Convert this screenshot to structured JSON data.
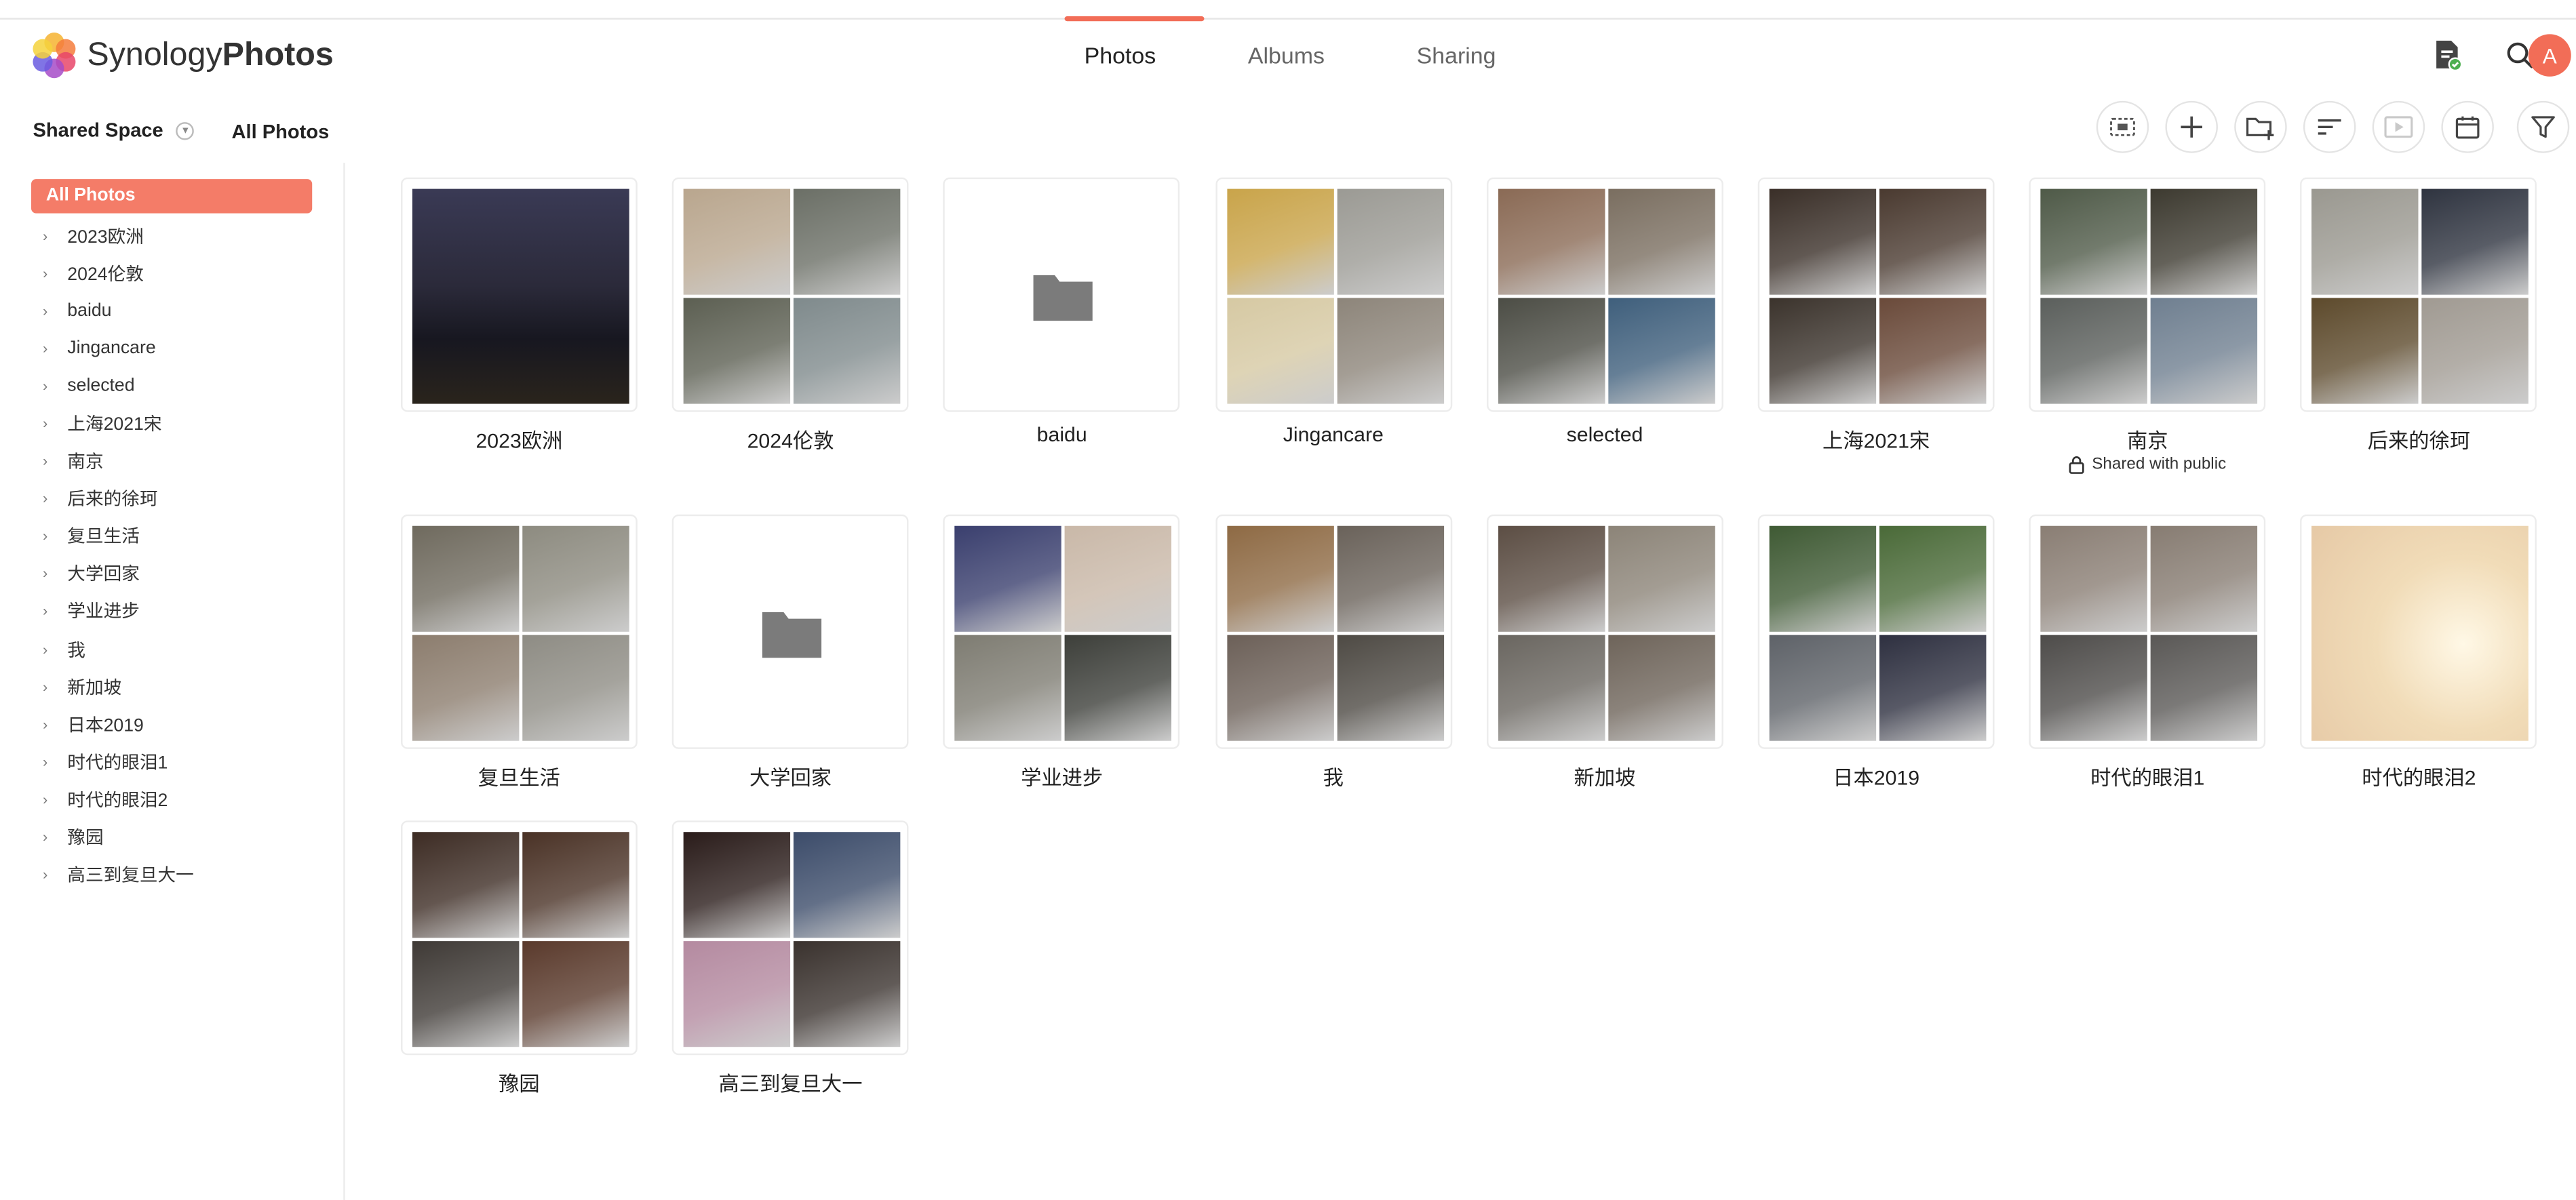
{
  "app": {
    "brand_light": "Synology",
    "brand_bold": "Photos",
    "accent_color": "#f26d57"
  },
  "header": {
    "tabs": [
      {
        "label": "Photos",
        "active": true
      },
      {
        "label": "Albums",
        "active": false
      },
      {
        "label": "Sharing",
        "active": false
      }
    ],
    "icons": [
      "task-status-icon",
      "search-icon"
    ],
    "avatar_letter": "A"
  },
  "subheader": {
    "space": "Shared Space",
    "current": "All Photos",
    "toolbar": [
      {
        "name": "select-icon",
        "disabled": false
      },
      {
        "name": "plus-icon",
        "disabled": false
      },
      {
        "name": "new-folder-icon",
        "disabled": false
      },
      {
        "name": "sort-icon",
        "disabled": false
      },
      {
        "name": "slideshow-icon",
        "disabled": true
      },
      {
        "name": "calendar-icon",
        "disabled": false
      },
      {
        "name": "filter-icon",
        "disabled": false
      }
    ]
  },
  "sidebar": {
    "active": "All Photos",
    "items": [
      "2023欧洲",
      "2024伦敦",
      "baidu",
      "Jingancare",
      "selected",
      "上海2021宋",
      "南京",
      "后来的徐珂",
      "复旦生活",
      "大学回家",
      "学业进步",
      "我",
      "新加坡",
      "日本2019",
      "时代的眼泪1",
      "时代的眼泪2",
      "豫园",
      "高三到复旦大一"
    ]
  },
  "albums": [
    {
      "name": "2023欧洲",
      "type": "single",
      "colors": [
        "#2b2a3a"
      ]
    },
    {
      "name": "2024伦敦",
      "type": "mosaic",
      "colors": [
        "#b9a68e",
        "#6b6f66",
        "#5c5f52",
        "#7f8a8c"
      ]
    },
    {
      "name": "baidu",
      "type": "folder"
    },
    {
      "name": "Jingancare",
      "type": "mosaic",
      "colors": [
        "#c9a44a",
        "#9b9a94",
        "#d6c9a3",
        "#8d857a"
      ]
    },
    {
      "name": "selected",
      "type": "mosaic",
      "colors": [
        "#8a6a55",
        "#7a6e60",
        "#4c4d45",
        "#3f5f7c"
      ]
    },
    {
      "name": "上海2021宋",
      "type": "mosaic",
      "colors": [
        "#3a2f28",
        "#4a3a30",
        "#3b332c",
        "#6a4a3a"
      ]
    },
    {
      "name": "南京",
      "type": "mosaic",
      "colors": [
        "#4f5a48",
        "#3d3a30",
        "#5b5f5c",
        "#6f7f90"
      ],
      "shared": "Shared with public"
    },
    {
      "name": "后来的徐珂",
      "type": "mosaic",
      "colors": [
        "#9a9890",
        "#2f3440",
        "#5d4a2c",
        "#a09a92"
      ]
    },
    {
      "name": "复旦生活",
      "type": "mosaic",
      "colors": [
        "#6f6a5e",
        "#8d8b80",
        "#8c7d6e",
        "#8e8c84"
      ]
    },
    {
      "name": "大学回家",
      "type": "folder"
    },
    {
      "name": "学业进步",
      "type": "mosaic",
      "colors": [
        "#3a3f6e",
        "#c9b8a8",
        "#7e7c72",
        "#3d3f3a"
      ]
    },
    {
      "name": "我",
      "type": "mosaic",
      "colors": [
        "#8e6a44",
        "#6a625a",
        "#6c6058",
        "#4e4a44"
      ]
    },
    {
      "name": "新加坡",
      "type": "mosaic",
      "colors": [
        "#5c4e44",
        "#8c8478",
        "#6a6660",
        "#6e645a"
      ]
    },
    {
      "name": "日本2019",
      "type": "mosaic",
      "colors": [
        "#3f5a34",
        "#4a6a38",
        "#5e6268",
        "#2e3040"
      ]
    },
    {
      "name": "时代的眼泪1",
      "type": "mosaic",
      "colors": [
        "#8a7e74",
        "#877c72",
        "#4e4c4a",
        "#5a5856"
      ]
    },
    {
      "name": "时代的眼泪2",
      "type": "single",
      "colors": [
        "#efd9b6"
      ]
    },
    {
      "name": "豫园",
      "type": "mosaic",
      "colors": [
        "#3d2c24",
        "#4a3226",
        "#3f3a36",
        "#5a3a2c"
      ]
    },
    {
      "name": "高三到复旦大一",
      "type": "mosaic",
      "colors": [
        "#2a1c1a",
        "#3c4c6a",
        "#b48aa0",
        "#3a322e"
      ]
    }
  ]
}
